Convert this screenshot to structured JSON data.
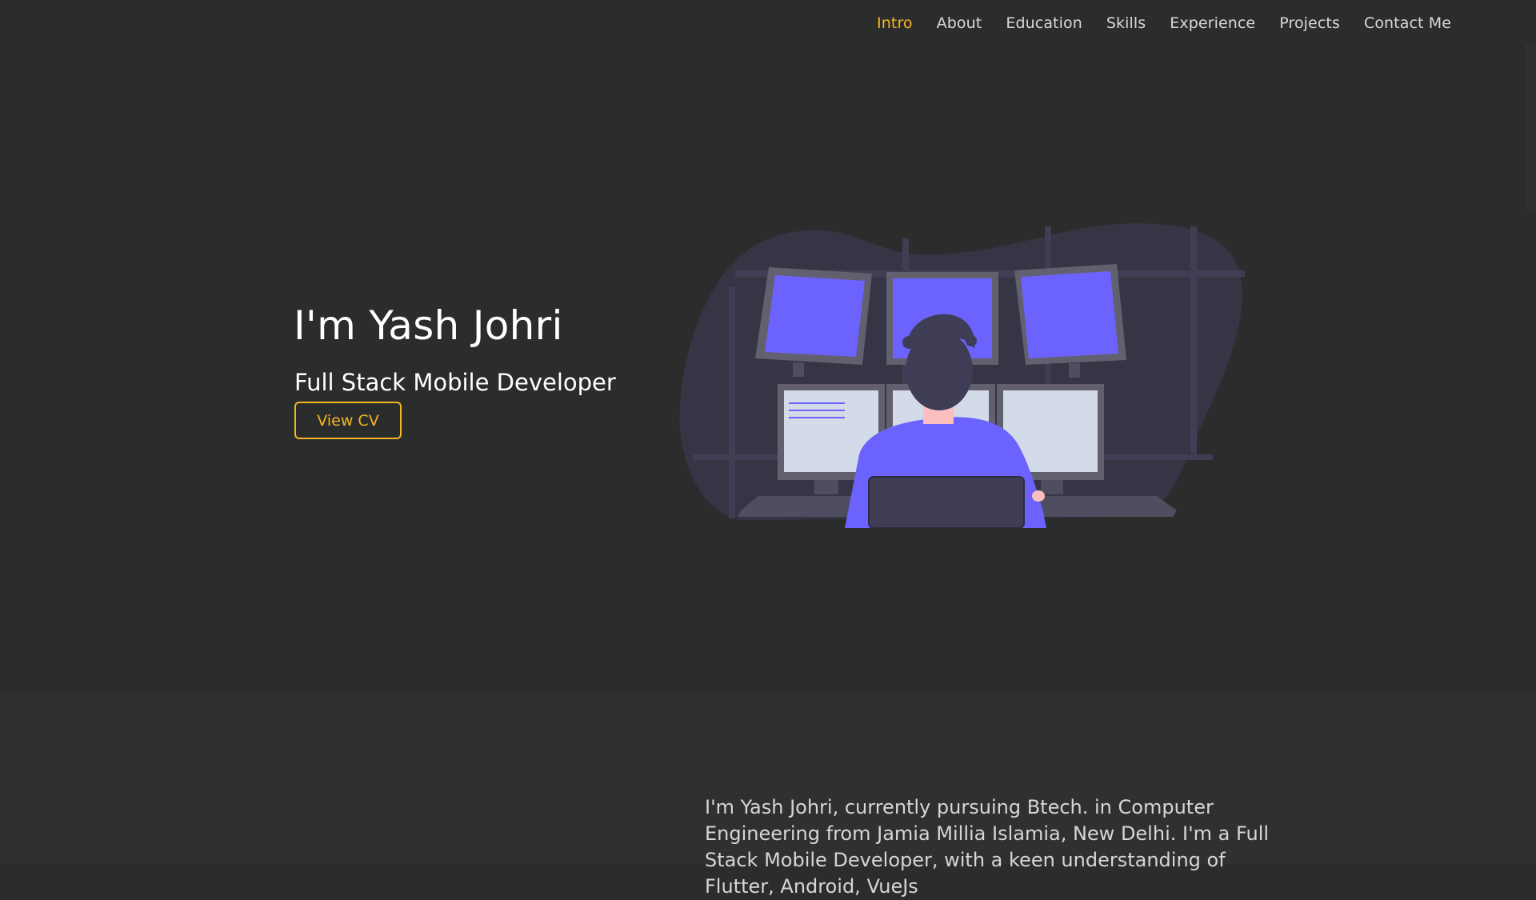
{
  "nav": {
    "items": [
      {
        "label": "Intro",
        "active": true
      },
      {
        "label": "About",
        "active": false
      },
      {
        "label": "Education",
        "active": false
      },
      {
        "label": "Skills",
        "active": false
      },
      {
        "label": "Experience",
        "active": false
      },
      {
        "label": "Projects",
        "active": false
      },
      {
        "label": "Contact Me",
        "active": false
      }
    ]
  },
  "hero": {
    "title": "I'm Yash Johri",
    "subtitle": "Full Stack Mobile Developer",
    "cv_button": "View CV",
    "illustration": "developer-at-multi-monitor-workstation"
  },
  "about": {
    "text": "I'm Yash Johri, currently pursuing Btech. in Computer Engineering from Jamia Millia Islamia, New Delhi. I'm a Full Stack Mobile Developer, with a keen understanding of Flutter, Android, VueJs"
  },
  "colors": {
    "background": "#2b2c2c",
    "section_alt": "#2f3030",
    "accent": "#f6b524",
    "text": "#ffffff",
    "muted_text": "#d8d8d8",
    "illustration_blob": "#363545",
    "illustration_screen": "#6c63ff"
  }
}
